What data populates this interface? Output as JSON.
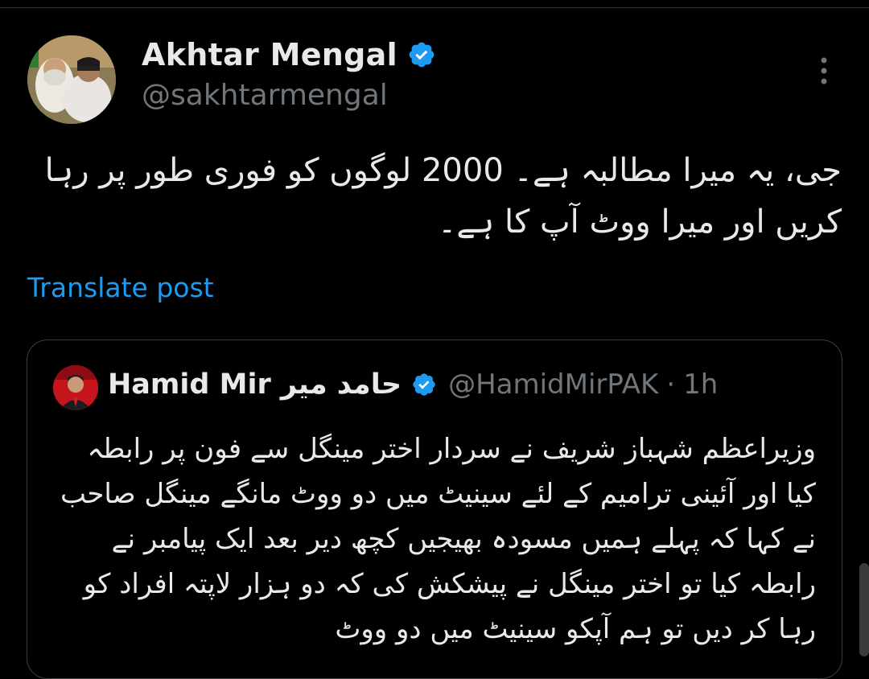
{
  "post": {
    "author_name": "Akhtar Mengal",
    "author_handle": "@sakhtarmengal",
    "text": "جی، یہ میرا مطالبہ ہے۔ 2000 لوگوں کو فوری طور پر رہا کریں اور میرا ووٹ آپ کا ہے۔",
    "translate_label": "Translate post"
  },
  "quoted": {
    "author_name": "Hamid Mir حامد میر",
    "author_handle": "@HamidMirPAK",
    "separator": "·",
    "time": "1h",
    "text": "وزیراعظم شہباز شریف نے سردار اختر مینگل سے فون پر رابطہ کیا اور آئینی ترامیم کے لئے سینیٹ میں دو ووٹ مانگے مینگل صاحب نے کہا کہ پہلے ہمیں مسودہ بھیجیں کچھ دیر بعد ایک پیامبر نے رابطہ کیا تو اختر مینگل نے پیشکش کی کہ دو ہزار لاپتہ افراد کو رہا کر دیں تو ہم آپکو سینیٹ میں دو ووٹ"
  },
  "icons": {
    "verified": "verified-badge-icon",
    "more": "more-options-icon"
  },
  "colors": {
    "background": "#000000",
    "text": "#e7e9ea",
    "muted": "#71767b",
    "link": "#1d9bf0",
    "verified": "#1d9bf0"
  }
}
